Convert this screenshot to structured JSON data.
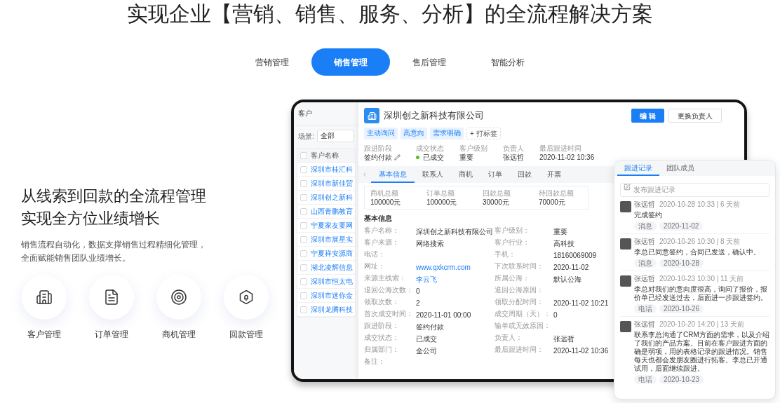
{
  "headline": "实现企业【营销、销售、服务、分析】的全流程解决方案",
  "tabs": [
    {
      "label": "营销管理",
      "selected": false
    },
    {
      "label": "销售管理",
      "selected": true
    },
    {
      "label": "售后管理",
      "selected": false
    },
    {
      "label": "智能分析",
      "selected": false
    }
  ],
  "feature": {
    "title_lines": [
      "从线索到回款的全流程管理",
      "实现全方位业绩增长"
    ],
    "description_lines": [
      "销售流程自动化，数据支撑销售过程精细化管理，",
      "全面赋能销售团队业绩增长。"
    ],
    "modules": [
      {
        "label": "客户管理",
        "kind": "building"
      },
      {
        "label": "订单管理",
        "kind": "document"
      },
      {
        "label": "商机管理",
        "kind": "target"
      },
      {
        "label": "回款管理",
        "kind": "bell"
      }
    ]
  },
  "crm": {
    "list": {
      "title": "客户",
      "scene_label": "场景:",
      "scene_value": "全部",
      "column": "客户名称",
      "header_checked": false,
      "rows": [
        {
          "name": "深圳市桂汇科",
          "checked": false
        },
        {
          "name": "深圳市新佳贸",
          "checked": false
        },
        {
          "name": "深圳创之新科",
          "checked": false
        },
        {
          "name": "山西青鹏教育",
          "checked": false
        },
        {
          "name": "宁夏家友要网",
          "checked": false
        },
        {
          "name": "深圳市展星实",
          "checked": false
        },
        {
          "name": "宁夏祥安源商",
          "checked": false
        },
        {
          "name": "湖北凌辉信息",
          "checked": false
        },
        {
          "name": "深圳市恒太电",
          "checked": false
        },
        {
          "name": "深圳市迷你金",
          "checked": false
        },
        {
          "name": "深圳龙腾科技",
          "checked": false
        }
      ]
    },
    "detail": {
      "company": "深圳创之新科技有限公司",
      "buttons": [
        {
          "label": "编 辑",
          "kind": "primary"
        },
        {
          "label": "更换负责人",
          "kind": "default"
        }
      ],
      "tags": [
        {
          "label": "主动询问",
          "kind": "tag"
        },
        {
          "label": "高意向",
          "kind": "tag"
        },
        {
          "label": "需求明确",
          "kind": "tag"
        },
        {
          "label": "+ 打标签",
          "kind": "add"
        }
      ],
      "summary": [
        {
          "label": "跟进阶段",
          "value": "签约付款",
          "kind": "edit"
        },
        {
          "label": "成交状态",
          "value": "已成交",
          "kind": "status"
        },
        {
          "label": "客户级别",
          "value": "重要",
          "kind": "plain"
        },
        {
          "label": "负责人",
          "value": "张远哲",
          "kind": "plain"
        },
        {
          "label": "最后跟进时间",
          "value": "2020-11-02 10:36",
          "kind": "plain"
        }
      ],
      "tabs": [
        {
          "label": "基本信息",
          "selected": true
        },
        {
          "label": "联系人",
          "selected": false
        },
        {
          "label": "商机",
          "selected": false
        },
        {
          "label": "订单",
          "selected": false
        },
        {
          "label": "回款",
          "selected": false
        },
        {
          "label": "开票",
          "selected": false
        }
      ],
      "stats": [
        {
          "label": "商机总额",
          "value": "100000元"
        },
        {
          "label": "订单总额",
          "value": "100000元"
        },
        {
          "label": "回款总额",
          "value": "30000元"
        },
        {
          "label": "待回款总额",
          "value": "70000元"
        }
      ],
      "section_title": "基本信息",
      "fields": [
        {
          "label": "客户名称：",
          "value": "深圳创之新科技有限公司",
          "kind": "text"
        },
        {
          "label": "客户级别：",
          "value": "重要",
          "kind": "text"
        },
        {
          "label": "客户来源：",
          "value": "网络搜索",
          "kind": "text"
        },
        {
          "label": "客户行业：",
          "value": "高科技",
          "kind": "text"
        },
        {
          "label": "电话："
        },
        {
          "label": "手机：",
          "value": "18160069009",
          "kind": "text"
        },
        {
          "label": "网址：",
          "value": "www.qxkcrm.com",
          "kind": "link"
        },
        {
          "label": "下次联系时间：",
          "value": "2020-11-02",
          "kind": "text"
        },
        {
          "label": "来源主线索：",
          "value": "李云飞",
          "kind": "link"
        },
        {
          "label": "所属公海：",
          "value": "默认公海",
          "kind": "text"
        },
        {
          "label": "退回公海次数：",
          "value": "0",
          "kind": "text"
        },
        {
          "label": "退回公海原因："
        },
        {
          "label": "领取次数：",
          "value": "2",
          "kind": "text"
        },
        {
          "label": "领取分配时间：",
          "value": "2020-11-02 10:21",
          "kind": "text"
        },
        {
          "label": "首次成交时间：",
          "value": "2020-11-01 00:00",
          "kind": "text"
        },
        {
          "label": "成交周期（天）：",
          "value": "0",
          "kind": "text"
        },
        {
          "label": "跟进阶段：",
          "value": "签约付款",
          "kind": "text"
        },
        {
          "label": "输单或无效原因："
        },
        {
          "label": "成交状态：",
          "value": "已成交",
          "kind": "text"
        },
        {
          "label": "负责人：",
          "value": "张远哲",
          "kind": "text"
        },
        {
          "label": "归属部门：",
          "value": "全公司",
          "kind": "text"
        },
        {
          "label": "最后跟进时间：",
          "value": "2020-11-02 10:36",
          "kind": "text"
        },
        {
          "label": "备注："
        }
      ]
    },
    "followup": {
      "tabs": [
        {
          "label": "跟进记录",
          "selected": true
        },
        {
          "label": "团队成员",
          "selected": false
        }
      ],
      "placeholder": "发布跟进记录",
      "records": [
        {
          "author": "张远哲",
          "time": "2020-10-28 10:33 | 6 天前",
          "content": "完成签约",
          "tags": [
            "消息",
            "2020-11-02"
          ]
        },
        {
          "author": "张远哲",
          "time": "2020-10-26 10:30 | 8 天前",
          "content": "李总已同意签约，合同已发送，确认中。",
          "tags": [
            "消息",
            "2020-10-28"
          ]
        },
        {
          "author": "张远哲",
          "time": "2020-10-23 10:30 | 11 天前",
          "content": "李总对我们的意向度很高，询问了报价，报价单已经发送过去，后面进一步跟进签约。",
          "tags": [
            "电话",
            "2020-10-26"
          ]
        },
        {
          "author": "张远哲",
          "time": "2020-10-20 14:20 | 13 天前",
          "content": "联系李总沟通了CRM方面的需求，以及介绍了我们的产品方案。目前在客户跟进方面的确是弱项，用的表格记录的跟进情况。销售每天也都会发朋友圈进行拓客。李总已开通试用，后面继续跟进。",
          "tags": [
            "电话",
            "2020-10-23"
          ]
        }
      ]
    }
  }
}
